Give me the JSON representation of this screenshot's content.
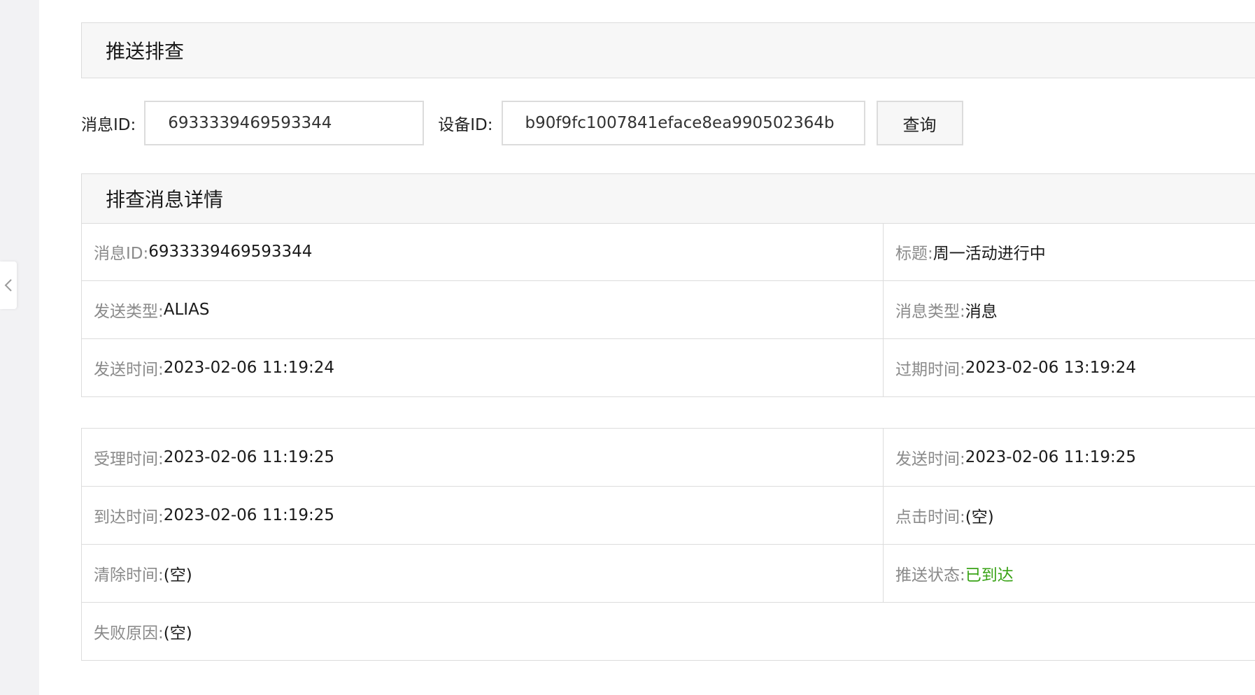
{
  "panel_title": "推送排查",
  "query": {
    "msg_label": "消息ID:",
    "msg_value": "6933339469593344",
    "device_label": "设备ID:",
    "device_value": "b90f9fc1007841eface8ea990502364b",
    "query_button": "查询"
  },
  "detail_title": "排查消息详情",
  "detail_rows": [
    [
      {
        "label": "消息ID:",
        "value": "6933339469593344"
      },
      {
        "label": "标题:",
        "value": "周一活动进行中"
      }
    ],
    [
      {
        "label": "发送类型:",
        "value": "ALIAS"
      },
      {
        "label": "消息类型:",
        "value": "消息"
      }
    ],
    [
      {
        "label": "发送时间:",
        "value": "2023-02-06 11:19:24"
      },
      {
        "label": "过期时间:",
        "value": "2023-02-06 13:19:24"
      }
    ]
  ],
  "status_rows": [
    [
      {
        "label": "受理时间:",
        "value": "2023-02-06 11:19:25"
      },
      {
        "label": "发送时间:",
        "value": "2023-02-06 11:19:25"
      }
    ],
    [
      {
        "label": "到达时间:",
        "value": "2023-02-06 11:19:25"
      },
      {
        "label": "点击时间:",
        "value": "(空)"
      }
    ],
    [
      {
        "label": "清除时间:",
        "value": "(空)"
      },
      {
        "label": "推送状态:",
        "value": "已到达"
      }
    ],
    [
      {
        "label": "失败原因:",
        "value": "(空)"
      }
    ]
  ],
  "colors": {
    "status_ok": "#3aa317",
    "label_gray": "#8a8a8a",
    "border": "#dcdcdc",
    "header_bg": "#f7f7f7"
  },
  "icons": {
    "collapse": "chevron-left-icon"
  }
}
